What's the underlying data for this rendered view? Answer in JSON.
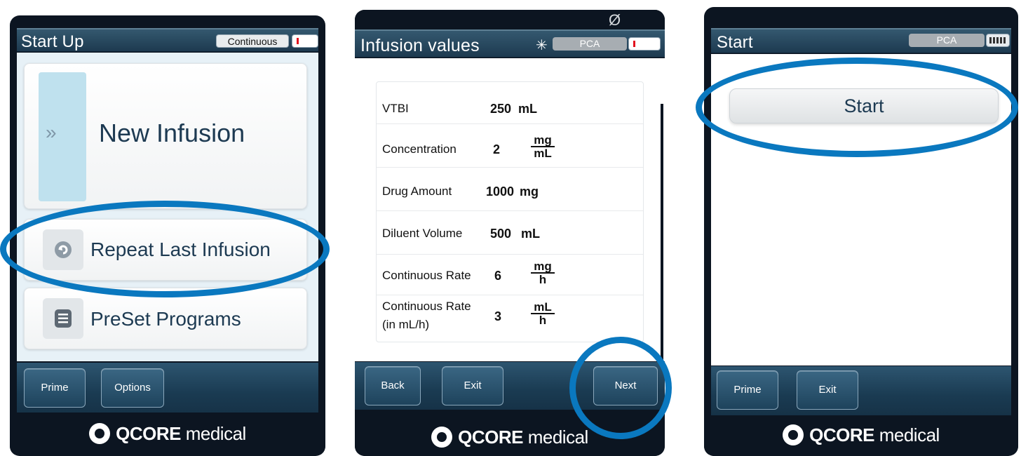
{
  "screen1": {
    "title": "Start Up",
    "mode": "Continuous",
    "menu": {
      "new_infusion": "New Infusion",
      "repeat_last": "Repeat Last Infusion",
      "preset_programs": "PreSet Programs"
    },
    "softkeys": {
      "prime": "Prime",
      "options": "Options"
    },
    "brand": {
      "bold": "QCORE",
      "light": " medical"
    }
  },
  "screen2": {
    "title": "Infusion values",
    "mode": "PCA",
    "status_symbol": "Ø",
    "rows": [
      {
        "label": "VTBI",
        "value": "250",
        "unit": "mL"
      },
      {
        "label": "Concentration",
        "value": "2",
        "unit_num": "mg",
        "unit_den": "mL"
      },
      {
        "label": "Drug Amount",
        "value": "1000",
        "unit": "mg"
      },
      {
        "label": "Diluent Volume",
        "value": "500",
        "unit": "mL"
      },
      {
        "label": "Continuous Rate",
        "value": "6",
        "unit_num": "mg",
        "unit_den": "h"
      },
      {
        "label": "Continuous Rate",
        "label2": "(in mL/h)",
        "value": "3",
        "unit_num": "mL",
        "unit_den": "h"
      }
    ],
    "softkeys": {
      "back": "Back",
      "exit": "Exit",
      "next": "Next"
    },
    "brand": {
      "bold": "QCORE",
      "light": " medical"
    }
  },
  "screen3": {
    "title": "Start",
    "mode": "PCA",
    "start_button": "Start",
    "softkeys": {
      "prime": "Prime",
      "exit": "Exit"
    },
    "brand": {
      "bold": "QCORE",
      "light": " medical"
    }
  },
  "colors": {
    "highlight": "#0a78bf",
    "titlebar": "#2a4b62",
    "text_dark": "#1d3a52",
    "battery_red": "#e2121e"
  }
}
